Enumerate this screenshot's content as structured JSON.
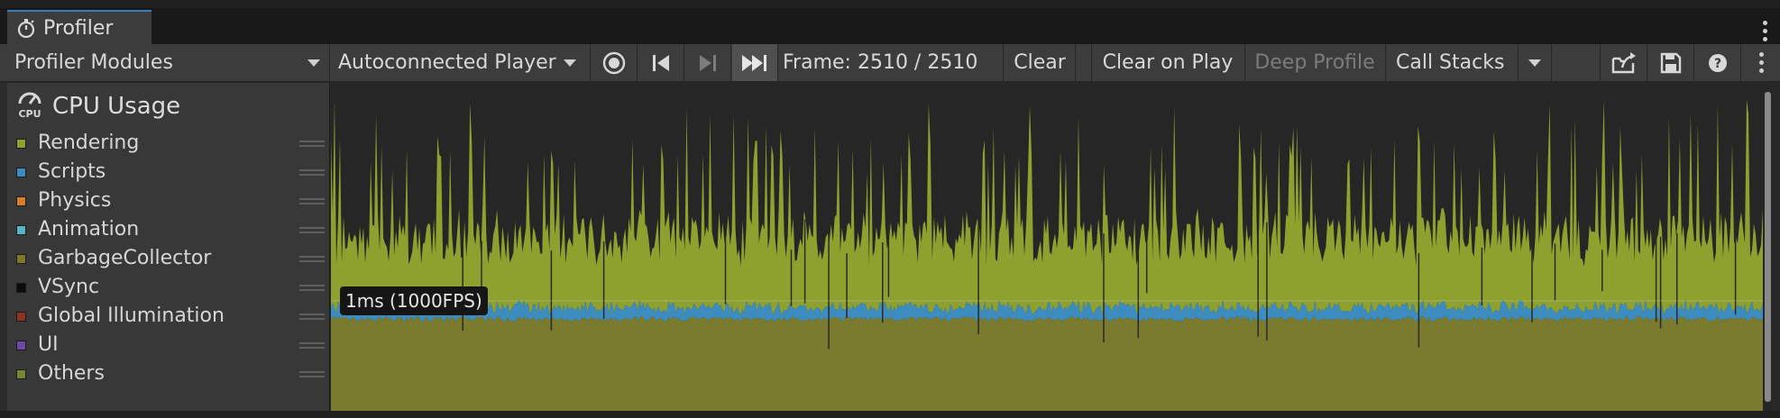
{
  "window": {
    "tab_title": "Profiler"
  },
  "toolbar": {
    "modules_label": "Profiler Modules",
    "target_label": "Autoconnected Player",
    "frame_text": "Frame: 2510 / 2510",
    "clear_label": "Clear",
    "clear_on_play_label": "Clear on Play",
    "deep_profile_label": "Deep Profile",
    "call_stacks_label": "Call Stacks",
    "icons": [
      "record-icon",
      "step-back-icon",
      "step-forward-icon",
      "skip-to-end-icon",
      "load-icon",
      "save-icon",
      "help-icon",
      "more-icon"
    ]
  },
  "module": {
    "title": "CPU Usage",
    "icon_text": "CPU",
    "series": [
      {
        "label": "Rendering",
        "color": "#8ea12f"
      },
      {
        "label": "Scripts",
        "color": "#3d8cbf"
      },
      {
        "label": "Physics",
        "color": "#d67f2a"
      },
      {
        "label": "Animation",
        "color": "#56b6c6"
      },
      {
        "label": "GarbageCollector",
        "color": "#7c7a28"
      },
      {
        "label": "VSync",
        "color": "#0c0c0c"
      },
      {
        "label": "Global Illumination",
        "color": "#8b3520"
      },
      {
        "label": "UI",
        "color": "#6a4aa3"
      },
      {
        "label": "Others",
        "color": "#748834"
      }
    ]
  },
  "chart": {
    "fps_label": "1ms (1000FPS)",
    "colors": {
      "others": "#7b7b30",
      "scripts": "#3d8cbf",
      "rendering": "#8ea12f",
      "background": "#262626",
      "accent": "#3a79bb"
    }
  }
}
